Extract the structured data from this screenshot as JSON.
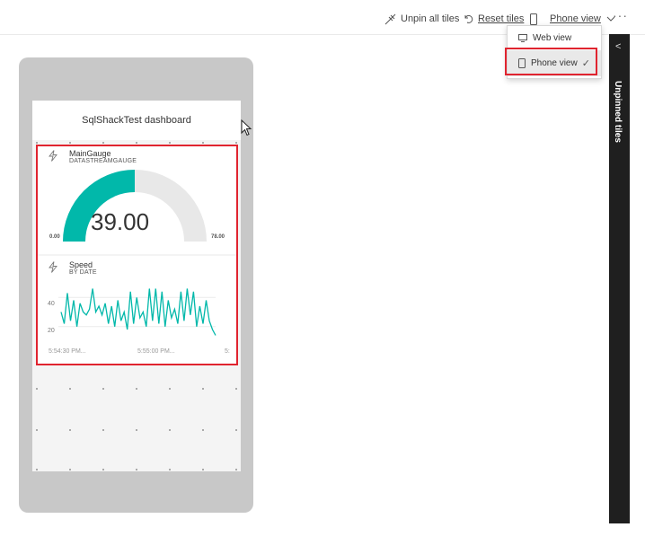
{
  "toolbar": {
    "unpin_all": "Unpin all tiles",
    "reset_tiles": "Reset tiles",
    "phone_view": "Phone view",
    "more": "···"
  },
  "view_menu": {
    "items": [
      {
        "label": "Web view",
        "selected": false
      },
      {
        "label": "Phone view",
        "selected": true
      }
    ],
    "check": "✓"
  },
  "side_panel": {
    "collapse": "<",
    "label": "Unpinned tiles"
  },
  "dashboard": {
    "title": "SqlShackTest dashboard"
  },
  "tiles": {
    "gauge": {
      "title": "MainGauge",
      "subtitle": "DATASTREAMGAUGE",
      "value": "39.00",
      "min_label": "0.00",
      "max_label": "78.00",
      "fill_fraction": 0.5
    },
    "speed": {
      "title": "Speed",
      "subtitle": "BY DATE",
      "y_ticks": [
        "40",
        "20"
      ],
      "x_tick_left": "5:54:30 PM...",
      "x_tick_mid": "5:55:00 PM...",
      "x_tick_right": "5:"
    }
  },
  "chart_data": {
    "type": "line",
    "title": "Speed",
    "subtitle": "BY DATE",
    "ylim": [
      10,
      50
    ],
    "y_ticks": [
      20,
      40
    ],
    "x_tick_labels": [
      "5:54:30 PM...",
      "5:55:00 PM...",
      "5:"
    ],
    "series": [
      {
        "values": [
          30,
          22,
          43,
          24,
          38,
          20,
          36,
          30,
          28,
          32,
          46,
          30,
          34,
          28,
          36,
          22,
          34,
          20,
          38,
          24,
          30,
          18,
          44,
          22,
          40,
          26,
          30,
          20,
          46,
          24,
          46,
          22,
          44,
          20,
          38,
          26,
          32,
          22,
          44,
          24,
          46,
          28,
          44,
          20,
          34,
          22,
          38,
          24,
          18,
          14
        ]
      }
    ],
    "color": "#01b8aa",
    "grid": true
  },
  "colors": {
    "accent": "#01b8aa",
    "gauge_track": "#e8e8e8",
    "highlight": "#e0242f"
  }
}
